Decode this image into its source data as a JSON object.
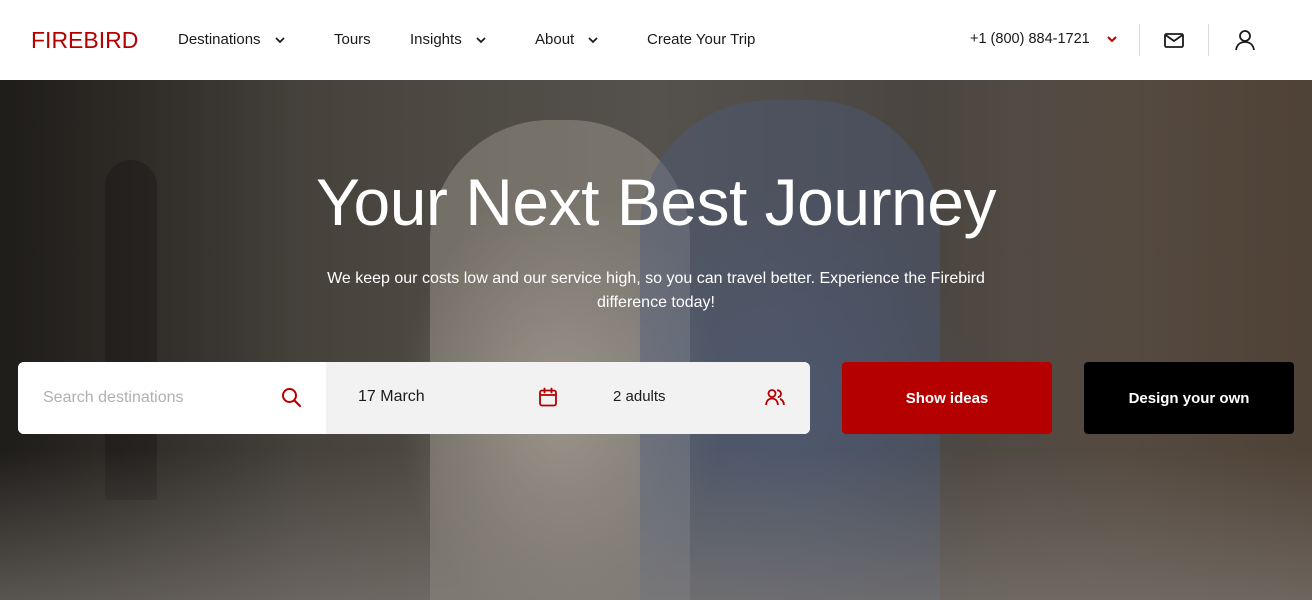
{
  "brand": {
    "logo_text": "FIREBIRD",
    "accent_color": "#b50000"
  },
  "nav": {
    "items": [
      {
        "label": "Destinations",
        "has_dropdown": true
      },
      {
        "label": "Tours",
        "has_dropdown": false
      },
      {
        "label": "Insights",
        "has_dropdown": true
      },
      {
        "label": "About",
        "has_dropdown": true
      },
      {
        "label": "Create Your Trip",
        "has_dropdown": false
      }
    ],
    "phone": "+1 (800) 884-1721",
    "icons": [
      "mail-icon",
      "user-icon"
    ]
  },
  "hero": {
    "title": "Your Next Best Journey",
    "subtitle": "We keep our costs low and our service high, so you can travel better. Experience the Firebird difference today!"
  },
  "search": {
    "placeholder": "Search destinations",
    "date": "17 March",
    "travelers": "2 adults",
    "icons": [
      "search-icon",
      "calendar-icon",
      "users-icon"
    ]
  },
  "buttons": {
    "show_ideas": "Show ideas",
    "design_own": "Design your own"
  }
}
